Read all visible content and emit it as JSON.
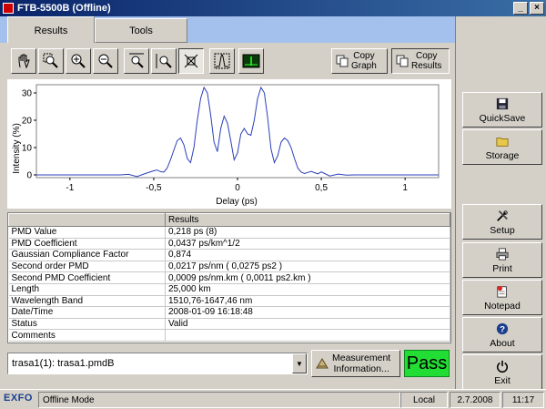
{
  "window": {
    "title": "FTB-5500B (Offline)"
  },
  "tabs": [
    {
      "label": "Results"
    },
    {
      "label": "Tools"
    }
  ],
  "toolbar": {
    "copy_graph": "Copy\nGraph",
    "copy_graph_l1": "Copy",
    "copy_graph_l2": "Graph",
    "copy_results_l1": "Copy",
    "copy_results_l2": "Results"
  },
  "chart_data": {
    "type": "line",
    "xlabel": "Delay (ps)",
    "ylabel": "Intensity (%)",
    "xlim": [
      -1.2,
      1.2
    ],
    "ylim": [
      -1,
      33
    ],
    "x_ticks": [
      "-1",
      "-0,5",
      "0",
      "0,5",
      "1"
    ],
    "x_tick_values": [
      -1,
      -0.5,
      0,
      0.5,
      1
    ],
    "y_ticks": [
      "0",
      "10",
      "20",
      "30"
    ],
    "y_tick_values": [
      0,
      10,
      20,
      30
    ],
    "series": [
      {
        "color": "#2b3fb8",
        "x": [
          -1.2,
          -0.7,
          -0.65,
          -0.6,
          -0.55,
          -0.5,
          -0.48,
          -0.46,
          -0.44,
          -0.42,
          -0.4,
          -0.38,
          -0.36,
          -0.34,
          -0.32,
          -0.3,
          -0.28,
          -0.26,
          -0.24,
          -0.22,
          -0.2,
          -0.18,
          -0.16,
          -0.14,
          -0.12,
          -0.1,
          -0.08,
          -0.06,
          -0.04,
          -0.02,
          0,
          0.02,
          0.04,
          0.06,
          0.08,
          0.1,
          0.12,
          0.14,
          0.16,
          0.18,
          0.2,
          0.22,
          0.24,
          0.26,
          0.28,
          0.3,
          0.32,
          0.34,
          0.36,
          0.38,
          0.4,
          0.42,
          0.44,
          0.46,
          0.48,
          0.5,
          0.52,
          0.55,
          0.6,
          0.65,
          0.7,
          1.2
        ],
        "y": [
          0,
          0,
          0.2,
          -0.6,
          0.5,
          1.5,
          1.8,
          1.2,
          1.0,
          2.5,
          5.5,
          9.0,
          12.5,
          13.5,
          11.0,
          6.0,
          4.5,
          10.0,
          20.0,
          28.0,
          32.0,
          30.0,
          22.0,
          12.0,
          8.5,
          17.0,
          21.5,
          19.0,
          12.5,
          5.5,
          8.0,
          15.0,
          17.0,
          15.0,
          14.5,
          20.0,
          28.0,
          32.0,
          30.0,
          21.0,
          9.5,
          4.5,
          7.0,
          12.0,
          13.5,
          12.5,
          10.0,
          6.0,
          2.5,
          1.0,
          0.5,
          0.9,
          1.3,
          0.8,
          0.4,
          1.1,
          0.5,
          -0.4,
          0.3,
          -0.1,
          0,
          0
        ]
      }
    ]
  },
  "results_table": {
    "headers": [
      "",
      "Results"
    ],
    "rows": [
      [
        "PMD Value",
        "0,218 ps (8)"
      ],
      [
        "PMD Coefficient",
        "0,0437 ps/km^1/2"
      ],
      [
        "Gaussian Compliance Factor",
        "0,874"
      ],
      [
        "Second order PMD",
        "0,0217 ps/nm  (  0,0275 ps2 )"
      ],
      [
        "Second PMD Coefficient",
        "0,0009 ps/nm.km  (  0,0011 ps2.km  )"
      ],
      [
        "Length",
        "25,000 km"
      ],
      [
        "Wavelength Band",
        "1510,76-1647,46 nm"
      ],
      [
        "Date/Time",
        "2008-01-09 16:18:48"
      ],
      [
        "Status",
        "Valid"
      ],
      [
        "Comments",
        ""
      ]
    ]
  },
  "measurement": {
    "select_value": "trasa1(1): trasa1.pmdB",
    "info_l1": "Measurement",
    "info_l2": "Information...",
    "verdict": "Pass"
  },
  "side_buttons": [
    {
      "label": "QuickSave",
      "icon": "floppy-icon"
    },
    {
      "label": "Storage",
      "icon": "folder-icon"
    },
    {
      "label": "Setup",
      "icon": "tools-icon"
    },
    {
      "label": "Print",
      "icon": "printer-icon"
    },
    {
      "label": "Notepad",
      "icon": "notepad-icon"
    },
    {
      "label": "About",
      "icon": "help-icon"
    },
    {
      "label": "Exit",
      "icon": "power-icon"
    }
  ],
  "statusbar": {
    "logo": "EXFO",
    "mode": "Offline Mode",
    "location": "Local",
    "date": "2.7.2008",
    "time": "11:17"
  },
  "colors": {
    "pass": "#22dd33",
    "curve": "#2b3fb8",
    "tab_strip": "#a4c0ec"
  }
}
